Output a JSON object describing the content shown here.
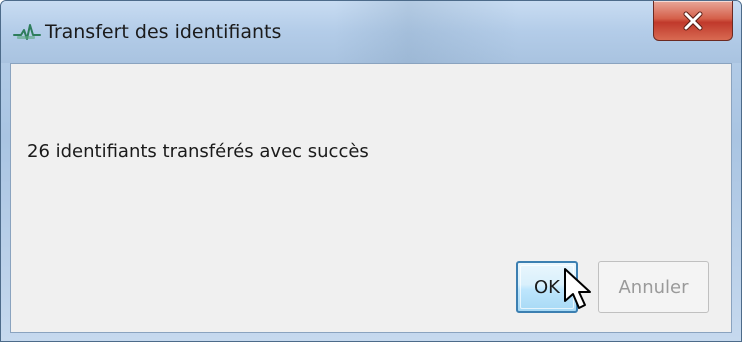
{
  "window": {
    "title": "Transfert des identifiants",
    "title_icon": "app-pulse-icon",
    "close_icon": "close-icon"
  },
  "dialog": {
    "message": "26 identifiants transférés avec succès",
    "ok_label": "OK",
    "cancel_label": "Annuler",
    "cancel_enabled": false
  },
  "colors": {
    "close_button": "#c0392b",
    "ok_button_border": "#3c7fb1",
    "client_background": "#f0f0f0",
    "disabled_text": "#9a9a9a"
  },
  "cursor": {
    "icon": "arrow-cursor-icon"
  }
}
